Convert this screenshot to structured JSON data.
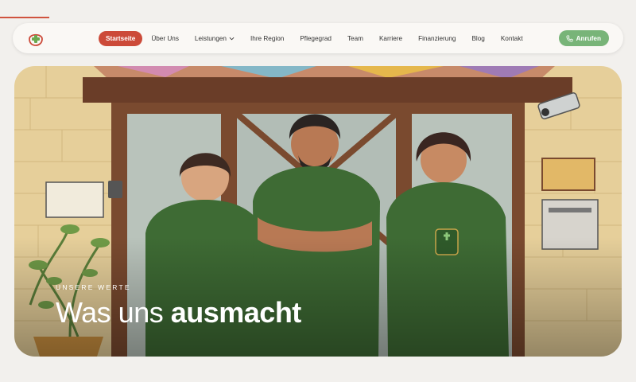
{
  "navbar": {
    "logo_icon": "medical-cross-logo-icon",
    "items": [
      {
        "label": "Startseite",
        "active": true
      },
      {
        "label": "Über Uns"
      },
      {
        "label": "Leistungen",
        "dropdown": true
      },
      {
        "label": "Ihre Region"
      },
      {
        "label": "Pflegegrad"
      },
      {
        "label": "Team"
      },
      {
        "label": "Karriere"
      },
      {
        "label": "Finanzierung"
      },
      {
        "label": "Blog"
      },
      {
        "label": "Kontakt"
      }
    ],
    "call_button": {
      "label": "Anrufen",
      "icon": "phone-icon"
    }
  },
  "hero": {
    "eyebrow": "UNSERE WERTE",
    "headline_regular": "Was uns",
    "headline_bold": "ausmacht"
  },
  "colors": {
    "accent_red": "#cc4a39",
    "call_green": "#78b478",
    "uniform_green": "#3e6b34"
  }
}
